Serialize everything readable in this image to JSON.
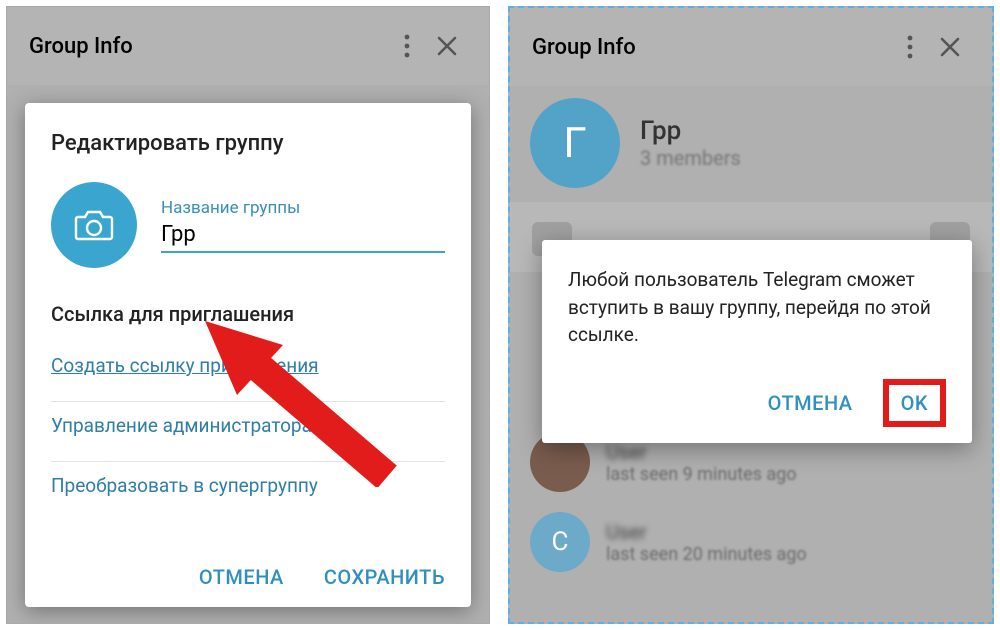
{
  "left": {
    "header_title": "Group Info",
    "dialog": {
      "title": "Редактировать группу",
      "group_name_label": "Название группы",
      "group_name_value": "Грр",
      "invite_section_title": "Ссылка для приглашения",
      "create_link": "Создать ссылку приглашения",
      "manage_admins": "Управление администраторам",
      "convert_supergroup": "Преобразовать в супергруппу",
      "cancel": "ОТМЕНА",
      "save": "СОХРАНИТЬ"
    }
  },
  "right": {
    "header_title": "Group Info",
    "group": {
      "name": "Грр",
      "avatar_letter": "Г",
      "members": "3 members"
    },
    "dialog": {
      "body": "Любой пользователь Telegram сможет вступить в вашу группу, перейдя по этой ссылке.",
      "cancel": "ОТМЕНА",
      "ok": "OK"
    },
    "members": [
      {
        "avatar_letter": "",
        "name": "User",
        "status": "last seen 9 minutes ago"
      },
      {
        "avatar_letter": "C",
        "name": "User",
        "status": "last seen 20 minutes ago"
      }
    ]
  }
}
